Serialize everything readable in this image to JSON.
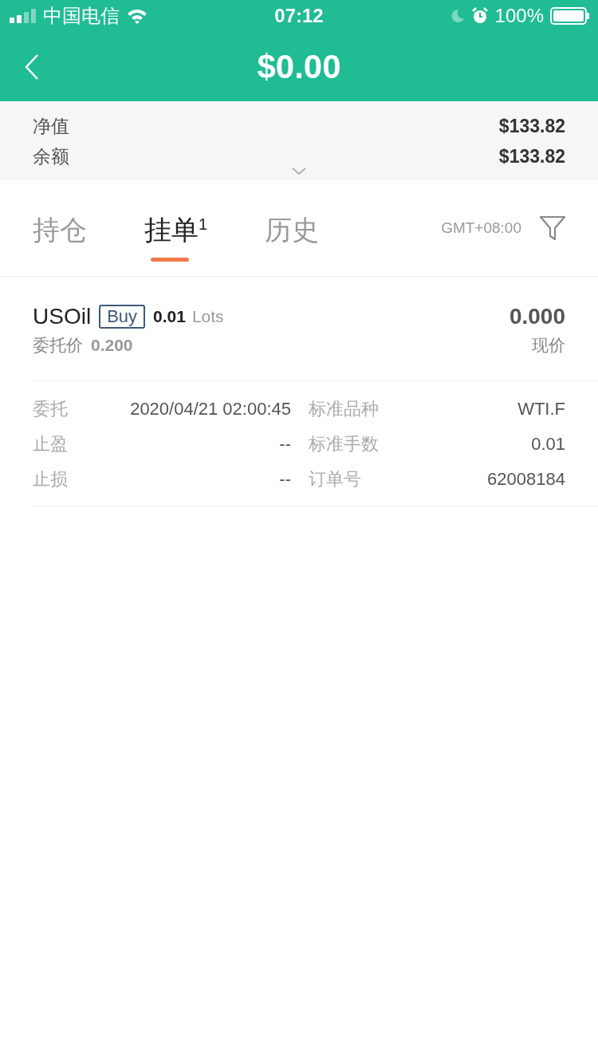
{
  "status_bar": {
    "carrier": "中国电信",
    "time": "07:12",
    "battery": "100%"
  },
  "header": {
    "title": "$0.00"
  },
  "summary": [
    {
      "label": "净值",
      "value": "$133.82"
    },
    {
      "label": "余额",
      "value": "$133.82"
    }
  ],
  "tabs": [
    {
      "label": "持仓",
      "selected": false
    },
    {
      "label": "挂单$^{1}$",
      "selected": true
    },
    {
      "label": "历史",
      "selected": false
    }
  ],
  "timezone": "GMT+08:00",
  "order": {
    "symbol": "USOil",
    "side": "Buy",
    "volume": "0.01",
    "unit": "Lots",
    "price_label": "委托价",
    "price": "0.200",
    "current": "0.000",
    "current_label": "现价",
    "details": [
      {
        "label": "委托",
        "value": "2020/04/21 02:00:45"
      },
      {
        "label": "标准品种",
        "value": "WTI.F"
      },
      {
        "label": "止盈",
        "value": "--"
      },
      {
        "label": "标准手数",
        "value": "0.01"
      },
      {
        "label": "止损",
        "value": "--"
      },
      {
        "label": "订单号",
        "value": "62008184"
      }
    ]
  }
}
